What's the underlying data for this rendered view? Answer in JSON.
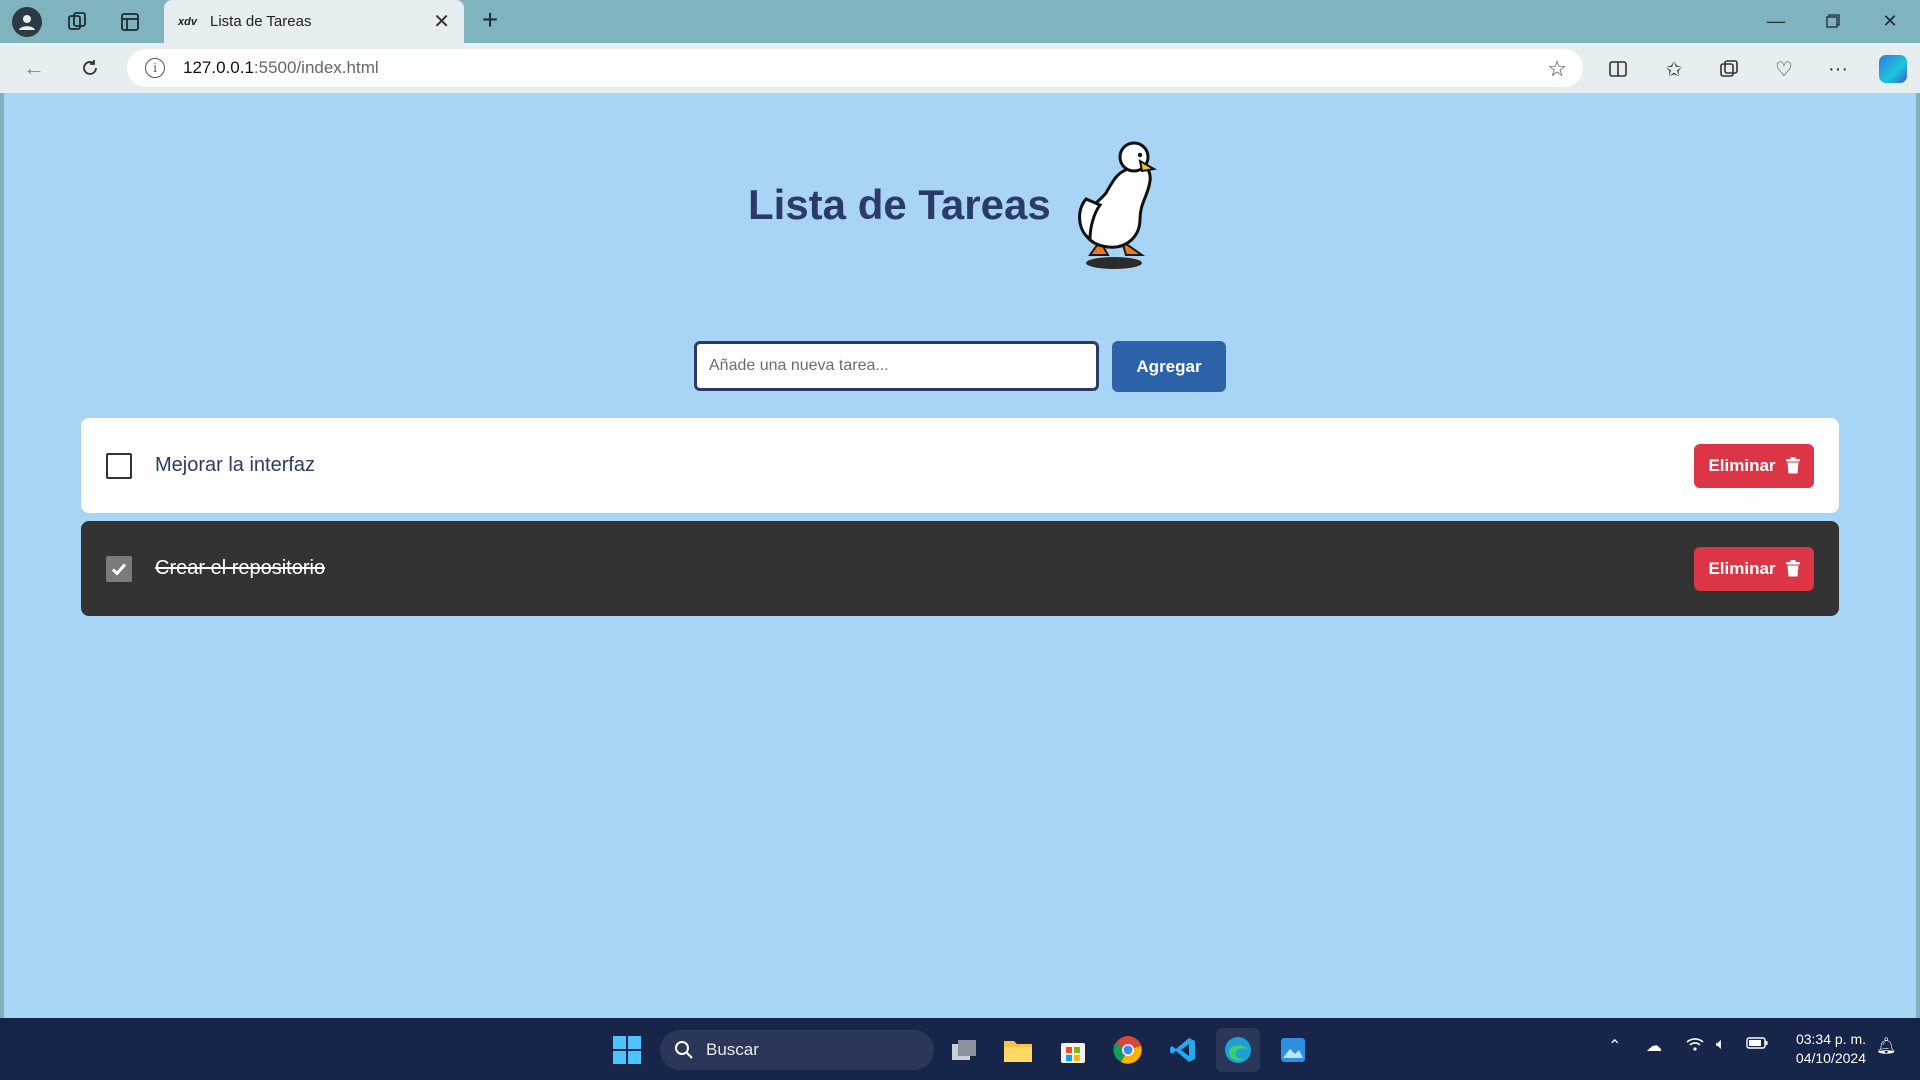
{
  "browser": {
    "tab_title": "Lista de Tareas",
    "tab_favicon_text": "xdv",
    "new_tab_symbol": "+",
    "url_host": "127.0.0.1",
    "url_rest": ":5500/index.html"
  },
  "app": {
    "title": "Lista de Tareas",
    "input_placeholder": "Añade una nueva tarea...",
    "input_value": "",
    "add_button_label": "Agregar",
    "tasks": [
      {
        "text": "Mejorar la interfaz",
        "completed": false,
        "delete_label": "Eliminar"
      },
      {
        "text": "Crear el repositorio",
        "completed": true,
        "delete_label": "Eliminar"
      }
    ]
  },
  "taskbar": {
    "search_label": "Buscar",
    "time": "03:34 p. m.",
    "date": "04/10/2024"
  },
  "colors": {
    "page_background": "#a8d4f5",
    "title_color": "#2b3a67",
    "add_button": "#2c62a8",
    "delete_button": "#dc3545",
    "completed_task_bg": "#333333"
  }
}
